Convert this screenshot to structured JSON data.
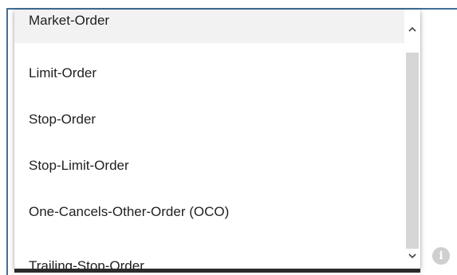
{
  "dropdown": {
    "options": [
      {
        "label": "Market-Order",
        "selected": true
      },
      {
        "label": "Limit-Order",
        "selected": false
      },
      {
        "label": "Stop-Order",
        "selected": false
      },
      {
        "label": "Stop-Limit-Order",
        "selected": false
      },
      {
        "label": "One-Cancels-Other-Order (OCO)",
        "selected": false
      },
      {
        "label": "Trailing-Stop-Order",
        "selected": false
      }
    ],
    "scroll_up_icon": "⌃",
    "scroll_down_icon": "⌄"
  },
  "info": {
    "icon": "i",
    "icon_name": "info-icon"
  },
  "colors": {
    "frame_border": "#3f6f9a",
    "selected_bg": "#f2f2f2",
    "scroll_thumb": "#d6d6d6",
    "info_icon_bg": "#cfcfcf"
  }
}
